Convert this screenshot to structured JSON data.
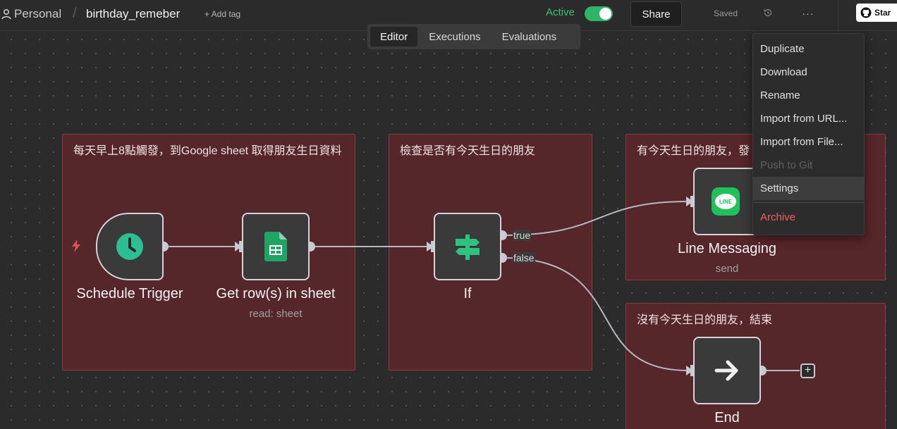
{
  "header": {
    "project": "Personal",
    "separator": "/",
    "workflow_name": "birthday_remeber",
    "add_tag": "+ Add tag",
    "active_label": "Active",
    "active": true,
    "share_label": "Share",
    "saved_label": "Saved",
    "more_label": "···",
    "github_label": "Star"
  },
  "view_tabs": {
    "items": [
      "Editor",
      "Executions",
      "Evaluations"
    ],
    "active": "Editor"
  },
  "sticky_notes": [
    "每天早上8點觸發，到Google sheet 取得朋友生日資料",
    "檢查是否有今天生日的朋友",
    "有今天生日的朋友，發",
    "沒有今天生日的朋友，結束"
  ],
  "nodes": {
    "schedule": {
      "label": "Schedule Trigger",
      "icon": "clock-icon"
    },
    "sheet": {
      "label": "Get row(s) in sheet",
      "subtitle": "read: sheet",
      "icon": "google-sheets-icon"
    },
    "if": {
      "label": "If",
      "icon": "signpost-icon",
      "outputs": [
        "true",
        "false"
      ]
    },
    "line": {
      "label": "Line Messaging",
      "subtitle": "send",
      "icon": "line-icon",
      "icon_text": "LINE"
    },
    "end": {
      "label": "End",
      "icon": "arrow-right-icon"
    }
  },
  "menu": {
    "items": [
      "Duplicate",
      "Download",
      "Rename",
      "Import from URL...",
      "Import from File...",
      "Push to Git",
      "Settings",
      "Archive"
    ],
    "disabled": [
      "Push to Git"
    ],
    "highlighted": "Settings",
    "danger": [
      "Archive"
    ]
  },
  "colors": {
    "accent_green": "#2fb567",
    "sticky_bg": "#55262a",
    "danger": "#f0605f",
    "canvas_bg": "#2b2b2b"
  }
}
